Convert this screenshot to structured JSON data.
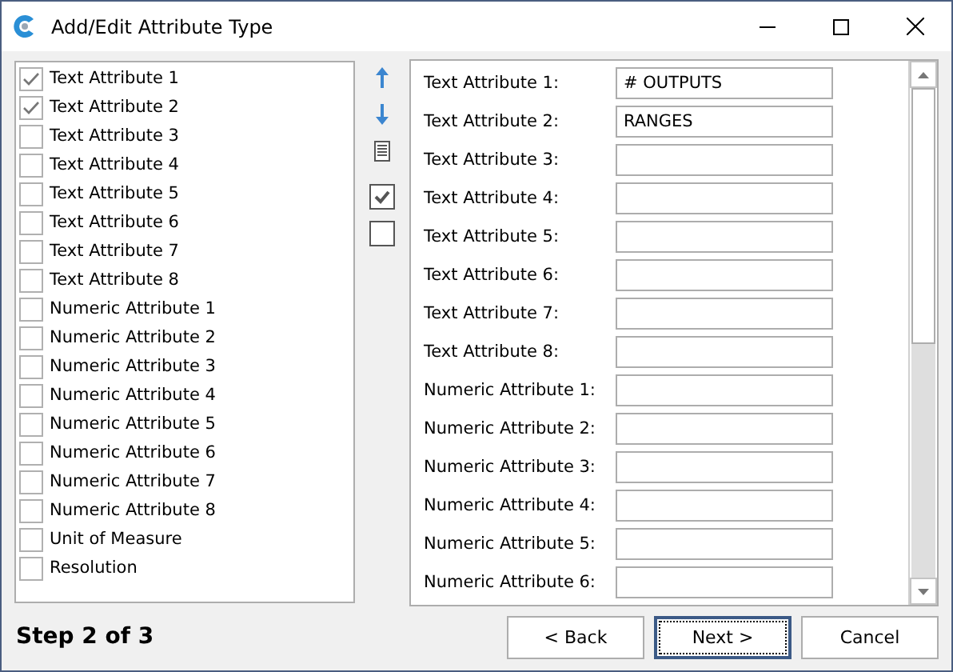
{
  "window": {
    "title": "Add/Edit Attribute Type"
  },
  "attributes": [
    {
      "label": "Text Attribute 1",
      "checked": true
    },
    {
      "label": "Text Attribute 2",
      "checked": true
    },
    {
      "label": "Text Attribute 3",
      "checked": false
    },
    {
      "label": "Text Attribute 4",
      "checked": false
    },
    {
      "label": "Text Attribute 5",
      "checked": false
    },
    {
      "label": "Text Attribute 6",
      "checked": false
    },
    {
      "label": "Text Attribute 7",
      "checked": false
    },
    {
      "label": "Text Attribute 8",
      "checked": false
    },
    {
      "label": "Numeric Attribute 1",
      "checked": false
    },
    {
      "label": "Numeric Attribute 2",
      "checked": false
    },
    {
      "label": "Numeric Attribute 3",
      "checked": false
    },
    {
      "label": "Numeric Attribute 4",
      "checked": false
    },
    {
      "label": "Numeric Attribute 5",
      "checked": false
    },
    {
      "label": "Numeric Attribute 6",
      "checked": false
    },
    {
      "label": "Numeric Attribute 7",
      "checked": false
    },
    {
      "label": "Numeric Attribute 8",
      "checked": false
    },
    {
      "label": "Unit of Measure",
      "checked": false
    },
    {
      "label": "Resolution",
      "checked": false
    }
  ],
  "fields": [
    {
      "label": "Text Attribute 1:",
      "value": "# OUTPUTS"
    },
    {
      "label": "Text Attribute 2:",
      "value": "RANGES"
    },
    {
      "label": "Text Attribute 3:"
    },
    {
      "label": "Text Attribute 4:"
    },
    {
      "label": "Text Attribute 5:"
    },
    {
      "label": "Text Attribute 6:"
    },
    {
      "label": "Text Attribute 7:"
    },
    {
      "label": "Text Attribute 8:"
    },
    {
      "label": "Numeric Attribute 1:"
    },
    {
      "label": "Numeric Attribute 2:"
    },
    {
      "label": "Numeric Attribute 3:"
    },
    {
      "label": "Numeric Attribute 4:"
    },
    {
      "label": "Numeric Attribute 5:"
    },
    {
      "label": "Numeric Attribute 6:"
    }
  ],
  "step": "Step 2 of 3",
  "buttons": [
    {
      "label": "< Back",
      "focused": false
    },
    {
      "label": "Next >",
      "focused": true
    },
    {
      "label": "Cancel",
      "focused": false
    }
  ]
}
